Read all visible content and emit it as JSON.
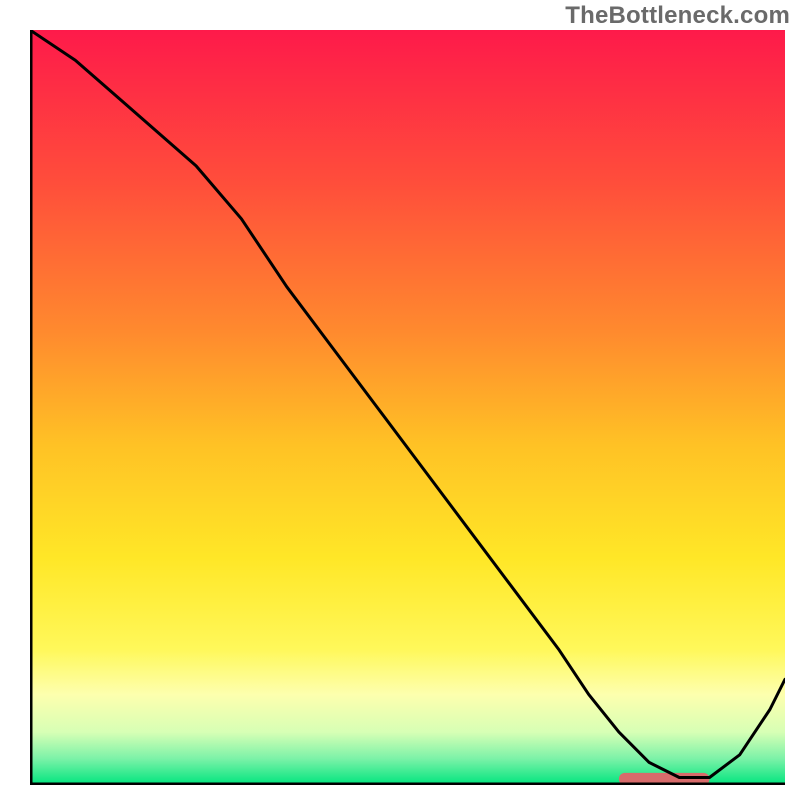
{
  "watermark": "TheBottleneck.com",
  "chart_data": {
    "type": "line",
    "title": "",
    "xlabel": "",
    "ylabel": "",
    "xlim": [
      0,
      100
    ],
    "ylim": [
      0,
      100
    ],
    "grid": false,
    "legend": false,
    "background_gradient": {
      "type": "vertical",
      "stops": [
        {
          "offset": 0.0,
          "color": "#fe1a4a"
        },
        {
          "offset": 0.2,
          "color": "#ff4d3b"
        },
        {
          "offset": 0.4,
          "color": "#ff8a2e"
        },
        {
          "offset": 0.55,
          "color": "#ffc225"
        },
        {
          "offset": 0.7,
          "color": "#ffe727"
        },
        {
          "offset": 0.82,
          "color": "#fff85a"
        },
        {
          "offset": 0.88,
          "color": "#fdffae"
        },
        {
          "offset": 0.93,
          "color": "#d7ffb5"
        },
        {
          "offset": 0.965,
          "color": "#7cf2a8"
        },
        {
          "offset": 1.0,
          "color": "#00e57e"
        }
      ]
    },
    "series": [
      {
        "name": "curve",
        "color": "#000000",
        "stroke_width": 3,
        "x": [
          0,
          6,
          14,
          22,
          28,
          34,
          40,
          46,
          52,
          58,
          64,
          70,
          74,
          78,
          82,
          86,
          90,
          94,
          98,
          100
        ],
        "values": [
          100,
          96,
          89,
          82,
          75,
          66,
          58,
          50,
          42,
          34,
          26,
          18,
          12,
          7,
          3,
          1,
          1,
          4,
          10,
          14
        ]
      }
    ],
    "annotations": [
      {
        "name": "optimal-marker",
        "type": "rounded_bar",
        "color": "#d86b6b",
        "x_start": 78,
        "x_end": 90,
        "y": 0.8,
        "height": 1.6
      }
    ],
    "axes": {
      "left": {
        "visible": true,
        "color": "#000000",
        "width": 5
      },
      "bottom": {
        "visible": true,
        "color": "#000000",
        "width": 5
      },
      "top": {
        "visible": false
      },
      "right": {
        "visible": false
      },
      "ticks": []
    }
  }
}
